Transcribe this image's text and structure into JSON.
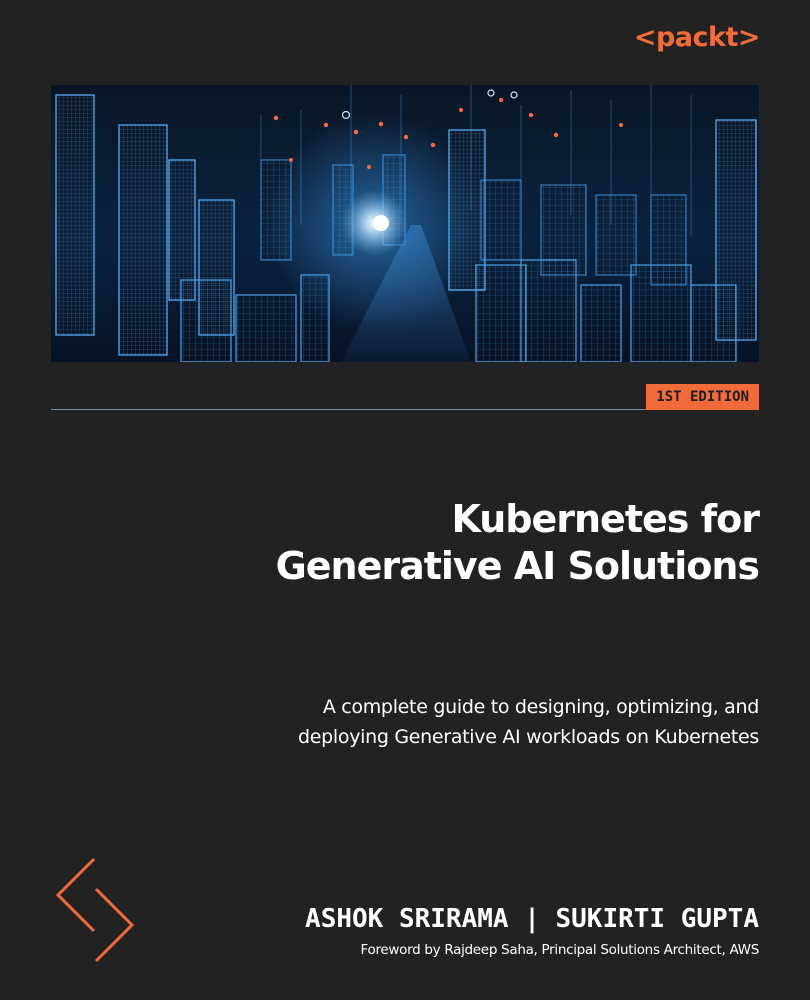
{
  "publisher": {
    "logo_text": "<packt>"
  },
  "hero": {
    "image_subject": "futuristic wireframe city skyline with glowing light"
  },
  "edition": {
    "label": "1ST EDITION"
  },
  "book": {
    "title_line1": "Kubernetes for",
    "title_line2": "Generative AI Solutions",
    "subtitle_line1": "A complete guide to designing, optimizing, and",
    "subtitle_line2": "deploying Generative AI workloads on Kubernetes",
    "authors": "ASHOK SRIRAMA | SUKIRTI GUPTA",
    "foreword": "Foreword by Rajdeep Saha, Principal Solutions Architect, AWS"
  },
  "colors": {
    "background": "#222222",
    "accent": "#f26b3a",
    "text": "#ffffff",
    "hero_glow": "#3fa9ff"
  },
  "icons": {
    "decor": "chevron-decor-icon"
  }
}
